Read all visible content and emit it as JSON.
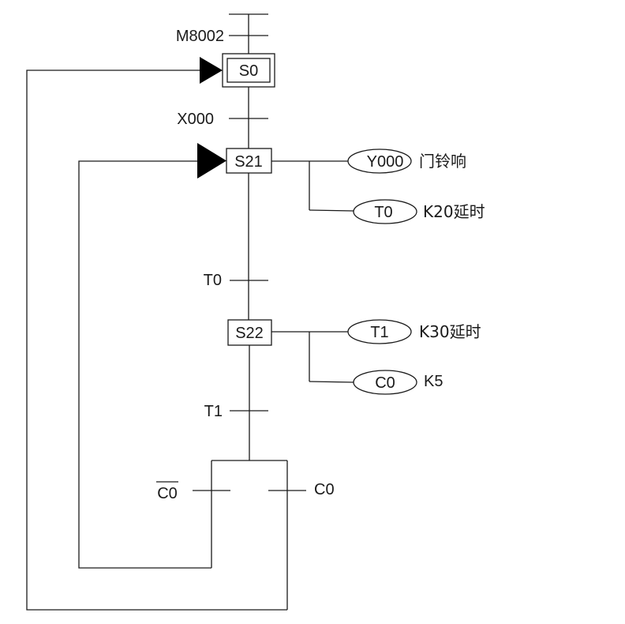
{
  "diagram": {
    "type": "sequential-function-chart",
    "initial_step": {
      "label": "S0"
    },
    "steps": [
      {
        "label": "S21",
        "outputs": [
          {
            "coil": "Y000",
            "note": "门铃响"
          },
          {
            "coil": "T0",
            "note": "K20延时"
          }
        ]
      },
      {
        "label": "S22",
        "outputs": [
          {
            "coil": "T1",
            "note": "K30延时"
          },
          {
            "coil": "C0",
            "note": "K5"
          }
        ]
      }
    ],
    "transitions": {
      "start": "M8002",
      "to_s21": "X000",
      "to_s22": "T0",
      "to_branch": "T1",
      "branch_left": "C0",
      "branch_left_negated": true,
      "branch_right": "C0"
    },
    "loops": [
      {
        "from": "branch-left (C0 not)",
        "to": "S21"
      },
      {
        "from": "branch-right (C0)",
        "to": "S0"
      }
    ]
  }
}
